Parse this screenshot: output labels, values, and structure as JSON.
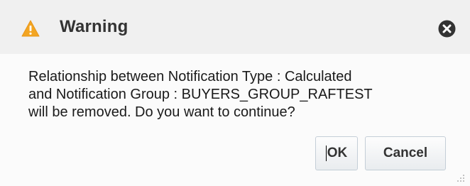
{
  "dialog": {
    "title": "Warning",
    "title_icon": "warning-triangle-icon",
    "close_icon": "close-circle-icon",
    "message": "Relationship between Notification Type : Calculated\nand Notification Group : BUYERS_GROUP_RAFTEST\nwill be removed. Do you want to continue?",
    "buttons": {
      "ok_label": "OK",
      "cancel_label": "Cancel"
    }
  },
  "colors": {
    "header_bg": "#f0f0f0",
    "body_bg": "#fbfbfb",
    "warning_yellow": "#f5a623",
    "text": "#1a1a1a"
  }
}
